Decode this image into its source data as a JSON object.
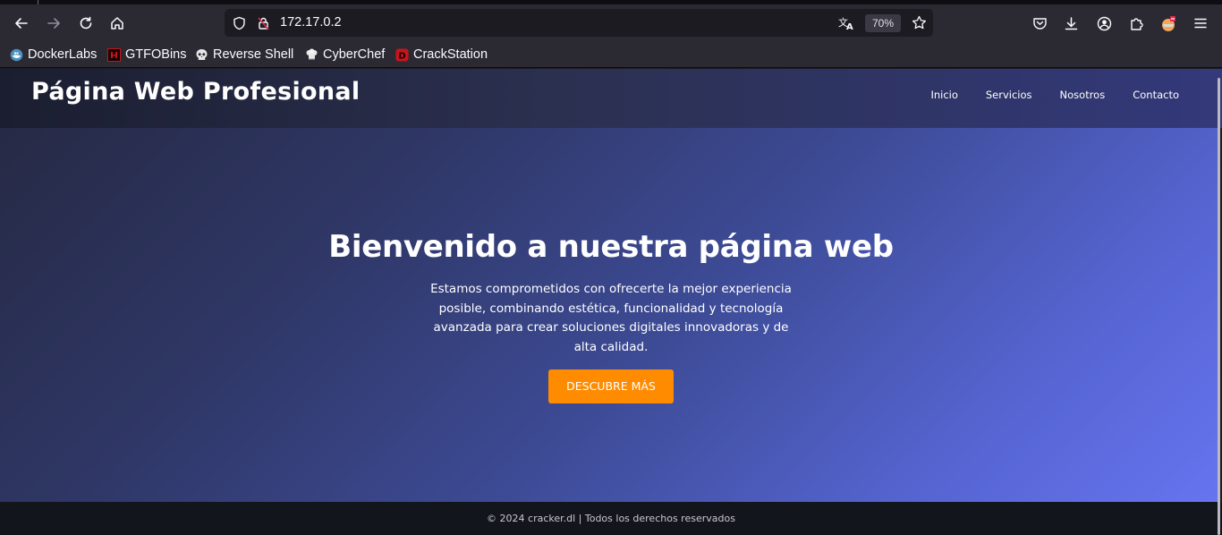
{
  "browser": {
    "url": "172.17.0.2",
    "zoom": "70%",
    "icons": {
      "back": "arrow-left-icon",
      "forward": "arrow-right-icon",
      "reload": "reload-icon",
      "home": "home-icon",
      "tracking": "shield-icon",
      "security": "lock-insecure-icon",
      "translate": "translate-icon",
      "bookmark_star": "star-icon",
      "pocket": "pocket-icon",
      "downloads": "download-icon",
      "account": "account-icon",
      "extensions": "puzzle-icon",
      "profile": "profile-avatar-icon",
      "menu": "hamburger-menu-icon"
    },
    "bookmarks": [
      {
        "label": "DockerLabs",
        "icon": "dockerlabs-icon"
      },
      {
        "label": "GTFOBins",
        "icon": "gtfobins-icon"
      },
      {
        "label": "Reverse Shell",
        "icon": "skull-icon"
      },
      {
        "label": "CyberChef",
        "icon": "chef-icon"
      },
      {
        "label": "CrackStation",
        "icon": "crackstation-icon"
      }
    ]
  },
  "site": {
    "title": "Página Web Profesional",
    "nav": [
      "Inicio",
      "Servicios",
      "Nosotros",
      "Contacto"
    ],
    "hero": {
      "heading": "Bienvenido a nuestra página web",
      "text": "Estamos comprometidos con ofrecerte la mejor experiencia posible, combinando estética, funcionalidad y tecnología avanzada para crear soluciones digitales innovadoras y de alta calidad.",
      "button": "DESCUBRE MÁS"
    },
    "footer": "© 2024 cracker.dl | Todos los derechos reservados"
  },
  "colors": {
    "accent_button": "#ff8c00",
    "hero_gradient_start": "#262a45",
    "hero_gradient_end": "#6674f0",
    "footer_bg": "#13151c",
    "chrome_bg": "#2b2a33"
  }
}
